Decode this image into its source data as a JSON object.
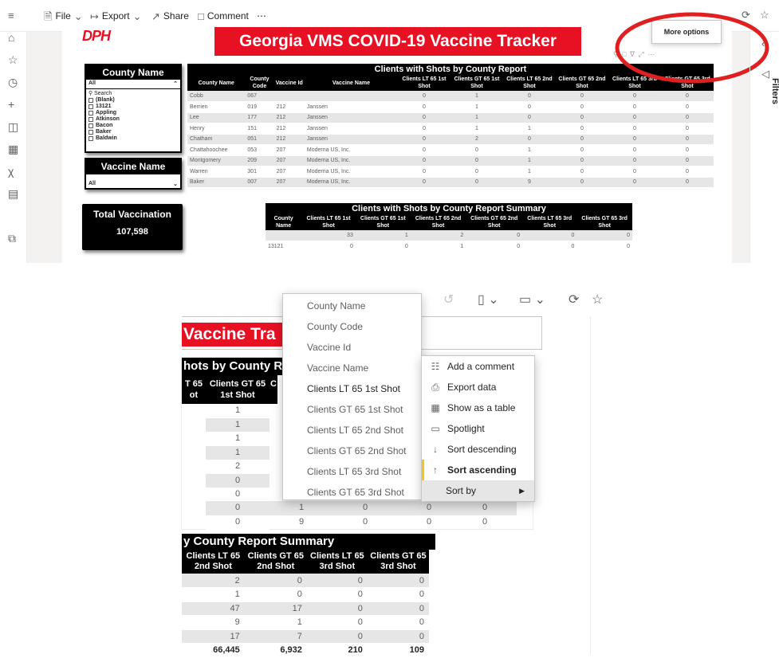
{
  "toolbar": {
    "file": "File",
    "export": "Export",
    "share": "Share",
    "comment": "Comment",
    "more": "⋯"
  },
  "report": {
    "logo": "DPH",
    "title": "Georgia VMS COVID-19 Vaccine Tracker",
    "more_options_tooltip": "More options",
    "filters_label": "Filters"
  },
  "county_slicer": {
    "title": "County Name",
    "selected": "All",
    "search_placeholder": "Search",
    "items": [
      "(Blank)",
      "13121",
      "Appling",
      "Atkinson",
      "Bacon",
      "Baker",
      "Baldwin"
    ]
  },
  "vaccine_slicer": {
    "title": "Vaccine Name",
    "selected": "All"
  },
  "total": {
    "label": "Total Vaccination",
    "value": "107,598"
  },
  "main_table": {
    "title": "Clients with Shots by County Report",
    "columns": [
      "County Name",
      "County Code",
      "Vaccine Id",
      "Vaccine Name",
      "Clients LT 65 1st Shot",
      "Clients GT 65 1st Shot",
      "Clients LT 65 2nd Shot",
      "Clients GT 65 2nd Shot",
      "Clients LT 65 3rd Shot",
      "Clients GT 65 3rd Shot"
    ],
    "rows": [
      [
        "Cobb",
        "067",
        "",
        "",
        "0",
        "1",
        "0",
        "0",
        "0",
        "0"
      ],
      [
        "Berrien",
        "019",
        "212",
        "Janssen",
        "0",
        "1",
        "0",
        "0",
        "0",
        "0"
      ],
      [
        "Lee",
        "177",
        "212",
        "Janssen",
        "0",
        "1",
        "0",
        "0",
        "0",
        "0"
      ],
      [
        "Henry",
        "151",
        "212",
        "Janssen",
        "0",
        "1",
        "1",
        "0",
        "0",
        "0"
      ],
      [
        "Chatham",
        "051",
        "212",
        "Janssen",
        "0",
        "2",
        "0",
        "0",
        "0",
        "0"
      ],
      [
        "Chattahoochee",
        "053",
        "207",
        "Moderna US, Inc.",
        "0",
        "0",
        "1",
        "0",
        "0",
        "0"
      ],
      [
        "Montgomery",
        "209",
        "207",
        "Moderna US, Inc.",
        "0",
        "0",
        "1",
        "0",
        "0",
        "0"
      ],
      [
        "Warren",
        "301",
        "207",
        "Moderna US, Inc.",
        "0",
        "0",
        "1",
        "0",
        "0",
        "0"
      ],
      [
        "Baker",
        "007",
        "207",
        "Moderna US, Inc.",
        "0",
        "0",
        "9",
        "0",
        "0",
        "0"
      ]
    ]
  },
  "summary_table": {
    "title": "Clients with Shots by County Report Summary",
    "columns": [
      "County Name",
      "Clients LT 65 1st Shot",
      "Clients GT 65 1st Shot",
      "Clients LT 65 2nd Shot",
      "Clients GT 65 2nd Shot",
      "Clients LT 65 3rd Shot",
      "Clients GT 65 3rd Shot"
    ],
    "rows": [
      [
        "",
        "33",
        "1",
        "2",
        "0",
        "0",
        "0"
      ],
      [
        "13121",
        "0",
        "0",
        "1",
        "0",
        "0",
        "0"
      ]
    ]
  },
  "zoom": {
    "title_fragment": "Vaccine Tra",
    "table_title_fragment": "hots by County R",
    "col_frag_1": "T 65\not",
    "col_frag_2": "Clients GT 65 1st Shot",
    "col_frag_3": "C",
    "gt65_1st_values": [
      "1",
      "1",
      "1",
      "1",
      "2",
      "0",
      "0",
      "0",
      "0"
    ],
    "bottom_rows": [
      [
        "0",
        "1",
        "0",
        "0",
        "0"
      ],
      [
        "0",
        "9",
        "0",
        "0",
        "0"
      ]
    ],
    "summary_title_fragment": "y County Report Summary",
    "summary_columns": [
      "Clients LT 65 2nd Shot",
      "Clients GT 65 2nd Shot",
      "Clients LT 65 3rd Shot",
      "Clients GT 65 3rd Shot"
    ],
    "summary_rows": [
      [
        "2",
        "0",
        "0",
        "0"
      ],
      [
        "1",
        "0",
        "0",
        "0"
      ],
      [
        "47",
        "17",
        "0",
        "0"
      ],
      [
        "9",
        "1",
        "0",
        "0"
      ],
      [
        "17",
        "7",
        "0",
        "0"
      ]
    ],
    "summary_totals": [
      "66,445",
      "6,932",
      "210",
      "109"
    ]
  },
  "sort_by_menu": {
    "items": [
      "County Name",
      "County Code",
      "Vaccine Id",
      "Vaccine Name",
      "Clients LT 65 1st Shot",
      "Clients GT 65 1st Shot",
      "Clients LT 65 2nd Shot",
      "Clients GT 65 2nd Shot",
      "Clients LT 65 3rd Shot",
      "Clients GT 65 3rd Shot"
    ],
    "active": "Clients LT 65 1st Shot"
  },
  "context_menu": {
    "items": [
      "Add a comment",
      "Export data",
      "Show as a table",
      "Spotlight",
      "Sort descending",
      "Sort ascending",
      "Sort by"
    ]
  },
  "colors": {
    "brand_red": "#e81123",
    "highlight_circle": "#e02020",
    "sort_asc_marker": "#f2c811"
  }
}
